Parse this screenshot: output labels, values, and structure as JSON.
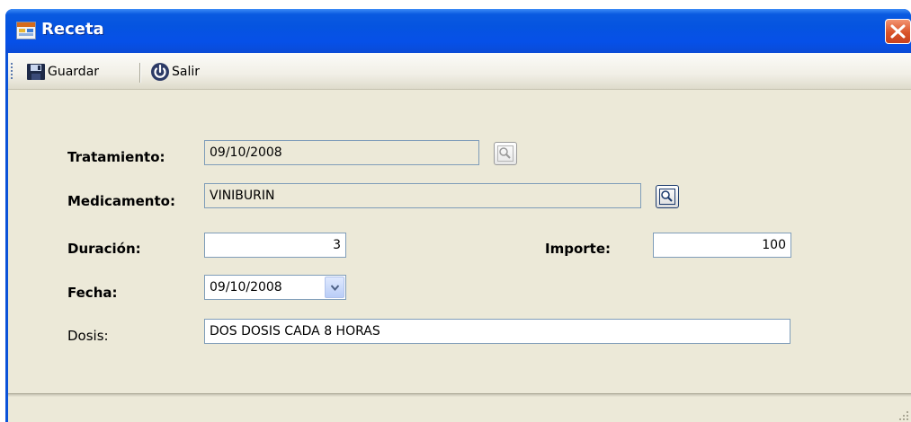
{
  "window": {
    "title": "Receta"
  },
  "toolbar": {
    "save_label": "Guardar",
    "exit_label": "Salir"
  },
  "form": {
    "tratamiento": {
      "label": "Tratamiento:",
      "value": "09/10/2008"
    },
    "medicamento": {
      "label": "Medicamento:",
      "value": "VINIBURIN"
    },
    "duracion": {
      "label": "Duración:",
      "value": "3"
    },
    "importe": {
      "label": "Importe:",
      "value": "100"
    },
    "fecha": {
      "label": "Fecha:",
      "value": "09/10/2008"
    },
    "dosis": {
      "label": "Dosis:",
      "value": "DOS DOSIS CADA 8 HORAS"
    }
  },
  "icons": {
    "app": "app-window-icon",
    "close": "close-icon",
    "save": "save-icon",
    "exit": "power-icon",
    "lookup": "search-icon",
    "dropdown": "chevron-down-icon",
    "resize": "resize-grip-icon"
  },
  "colors": {
    "titlebar": "#0554e0",
    "client_bg": "#ece9d8",
    "close_button": "#d9542a",
    "field_border": "#7f9db9"
  }
}
